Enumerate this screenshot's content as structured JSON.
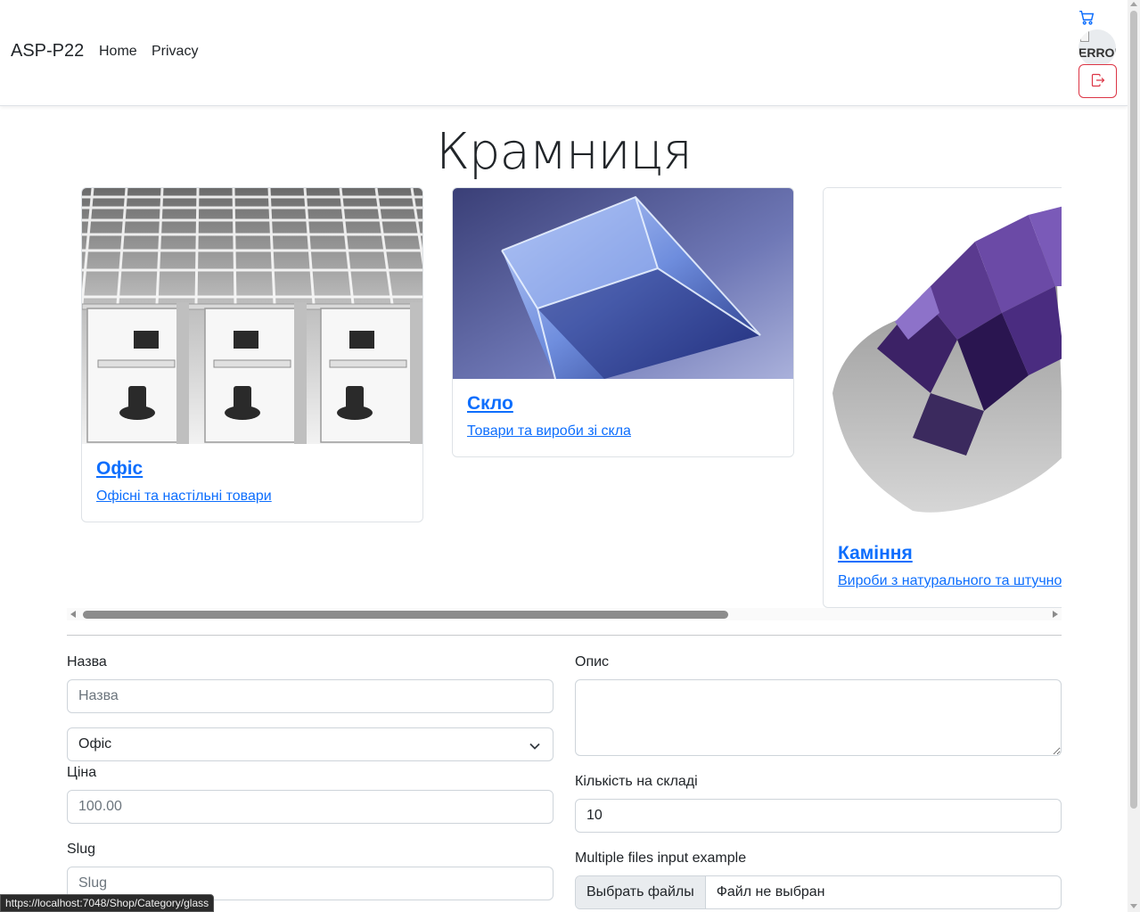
{
  "navbar": {
    "brand": "ASP-P22",
    "links": [
      "Home",
      "Privacy"
    ],
    "avatar_alt": "ERROR",
    "cart_icon": "cart-icon",
    "logout_icon": "box-arrow-right-icon",
    "logout_color": "#dc3545"
  },
  "main": {
    "title": "Крамниця",
    "categories": [
      {
        "title": "Офіс",
        "description": "Офісні та настільні товари"
      },
      {
        "title": "Скло",
        "description": "Товари та вироби зі скла"
      },
      {
        "title": "Каміння",
        "description": "Вироби з натурального та штучного каміння"
      }
    ]
  },
  "form": {
    "name_label": "Назва",
    "name_placeholder": "Назва",
    "category_selected": "Офіс",
    "price_label": "Ціна",
    "price_placeholder": "100.00",
    "slug_label": "Slug",
    "slug_placeholder": "Slug",
    "description_label": "Опис",
    "stock_label": "Кількість на складі",
    "stock_value": "10",
    "files_label": "Multiple files input example",
    "files_button": "Выбрать файлы",
    "files_status": "Файл не выбран"
  },
  "statusbar": {
    "url": "https://localhost:7048/Shop/Category/glass"
  },
  "colors": {
    "link": "#0d6efd",
    "danger": "#dc3545",
    "border": "#ced4da"
  }
}
